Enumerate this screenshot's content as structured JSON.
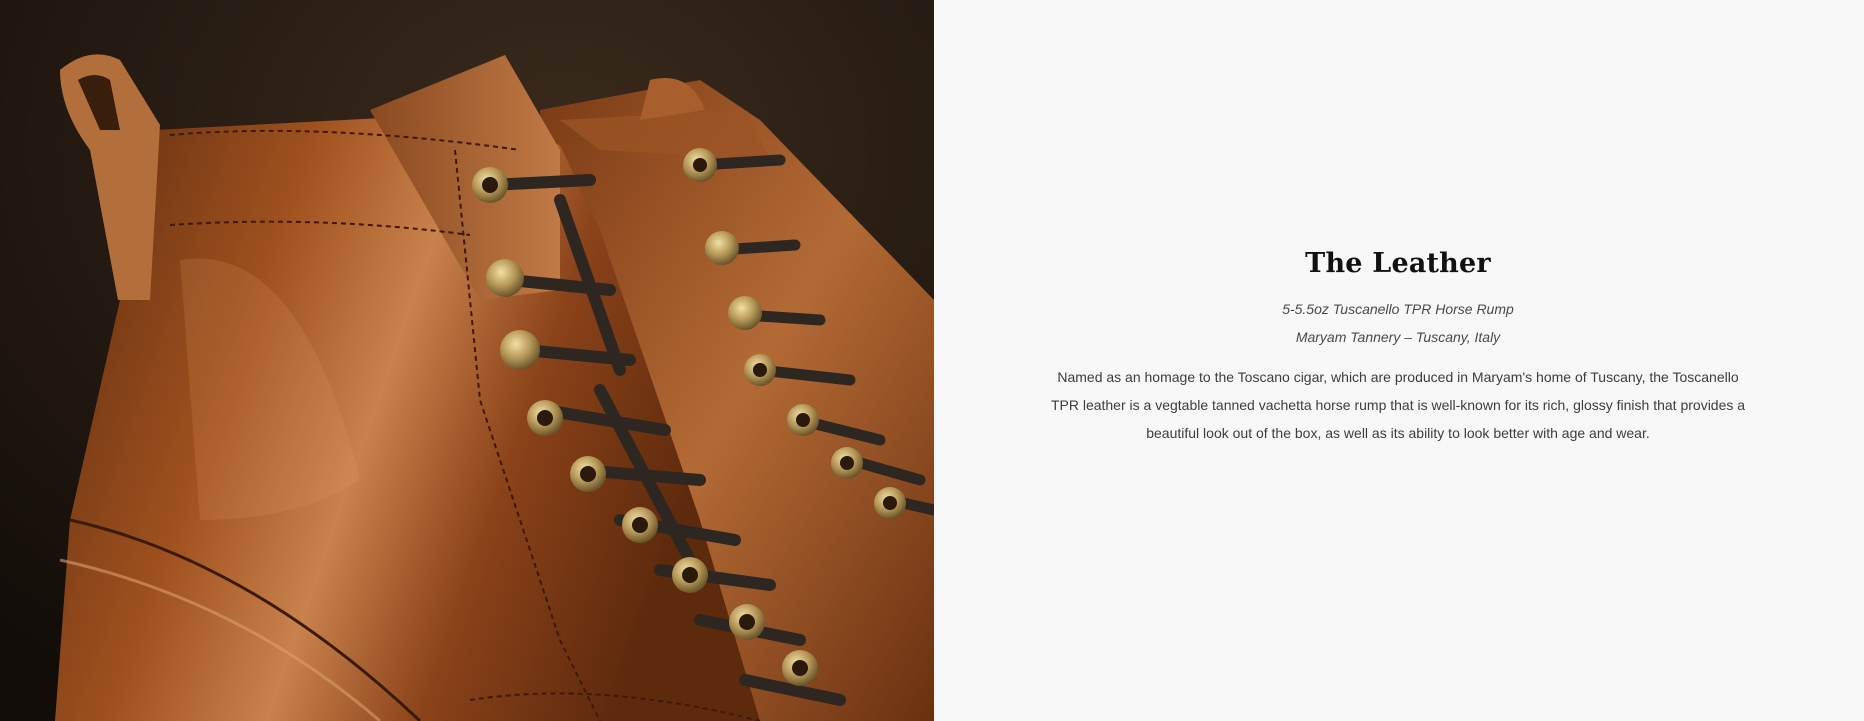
{
  "hero": {
    "image_icon": "leather-boots-photo"
  },
  "section": {
    "title": "The Leather",
    "spec_line_1": "5-5.5oz Tuscanello TPR Horse Rump",
    "spec_line_2": "Maryam Tannery – Tuscany, Italy",
    "description": "Named as an homage to the Toscano cigar, which are produced in Maryam's home of Tuscany, the Toscanello TPR leather is a vegtable tanned vachetta horse rump that is well-known for its rich, glossy finish that provides a beautiful look out of the box, as well as its ability to look better with age and wear."
  },
  "colors": {
    "background": "#f8f8f8",
    "leather": "#7a3a14",
    "leather_highlight": "#c47a45",
    "eyelet": "#b89a5a",
    "lace": "#2e2621"
  }
}
